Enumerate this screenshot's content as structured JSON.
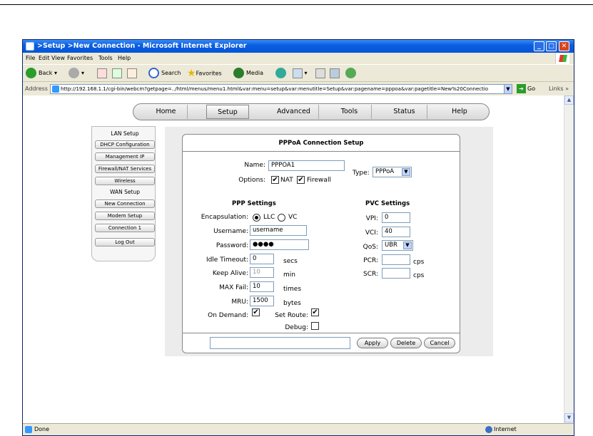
{
  "window": {
    "title": ">Setup >New Connection - Microsoft Internet Explorer",
    "min": "_",
    "max": "□",
    "close": "✕"
  },
  "menu": [
    "File",
    "Edit",
    "View",
    "Favorites",
    "Tools",
    "Help"
  ],
  "toolbar": {
    "back": "Back",
    "search": "Search",
    "favorites": "Favorites",
    "media": "Media"
  },
  "address": {
    "label": "Address",
    "url": "http://192.168.1.1/cgi-bin/webcm?getpage=../html/menus/menu1.html&var:menu=setup&var:menutitle=Setup&var:pagename=pppoa&var:pagetitle=New%20Connectio",
    "go": "Go",
    "links": "Links"
  },
  "nav": {
    "tabs": [
      "Home",
      "Setup",
      "Advanced",
      "Tools",
      "Status",
      "Help"
    ],
    "active": "Setup"
  },
  "sidebar": {
    "lan_heading": "LAN Setup",
    "lan_items": [
      "DHCP Configuration",
      "Management IP",
      "Firewall/NAT Services",
      "Wireless"
    ],
    "wan_heading": "WAN Setup",
    "wan_items": [
      "New Connection",
      "Modem Setup",
      "Connection 1"
    ],
    "logout": "Log Out"
  },
  "form": {
    "title": "PPPoA Connection Setup",
    "name_label": "Name:",
    "name_value": "PPPOA1",
    "type_label": "Type:",
    "type_value": "PPPoA",
    "options_label": "Options:",
    "nat_label": "NAT",
    "firewall_label": "Firewall",
    "ppp_heading": "PPP Settings",
    "pvc_heading": "PVC Settings",
    "encap_label": "Encapsulation:",
    "llc_label": "LLC",
    "vc_label": "VC",
    "username_label": "Username:",
    "username_value": "username",
    "password_label": "Password:",
    "password_value": "●●●●",
    "idle_label": "Idle Timeout:",
    "idle_value": "0",
    "idle_unit": "secs",
    "keepalive_label": "Keep Alive:",
    "keepalive_value": "10",
    "keepalive_unit": "min",
    "maxfail_label": "MAX Fail:",
    "maxfail_value": "10",
    "maxfail_unit": "times",
    "mru_label": "MRU:",
    "mru_value": "1500",
    "mru_unit": "bytes",
    "ondemand_label": "On Demand:",
    "setroute_label": "Set Route:",
    "debug_label": "Debug:",
    "vpi_label": "VPI:",
    "vpi_value": "0",
    "vci_label": "VCI:",
    "vci_value": "40",
    "qos_label": "QoS:",
    "qos_value": "UBR",
    "pcr_label": "PCR:",
    "pcr_unit": "cps",
    "scr_label": "SCR:",
    "scr_unit": "cps",
    "apply": "Apply",
    "delete": "Delete",
    "cancel": "Cancel"
  },
  "status": {
    "text": "Done",
    "zone": "Internet"
  }
}
